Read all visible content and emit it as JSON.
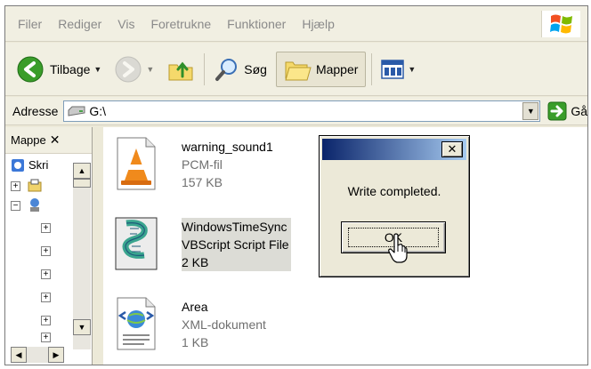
{
  "menubar": {
    "items": [
      "Filer",
      "Rediger",
      "Vis",
      "Foretrukne",
      "Funktioner",
      "Hjælp"
    ]
  },
  "toolbar": {
    "back_label": "Tilbage",
    "search_label": "Søg",
    "folders_label": "Mapper"
  },
  "address": {
    "label": "Adresse",
    "value": "G:\\",
    "go_label": "Gå"
  },
  "folder_pane": {
    "title": "Mappe",
    "tree_top_label": "Skri"
  },
  "files": [
    {
      "name": "warning_sound1",
      "type": "PCM-fil",
      "size": "157 KB",
      "icon": "vlc-cone-icon"
    },
    {
      "name": "WindowsTimeSync",
      "type": "VBScript Script File",
      "size": "2 KB",
      "icon": "vbscript-icon",
      "selected": true
    },
    {
      "name": "Area",
      "type": "XML-dokument",
      "size": "1 KB",
      "icon": "xml-document-icon"
    }
  ],
  "dialog": {
    "message": "Write completed.",
    "ok_label": "OK"
  },
  "colors": {
    "dialog_title_start": "#0a246a",
    "dialog_title_end": "#a6caf0",
    "back_button": "#3a9d2a",
    "window_bg": "#ece9d8"
  }
}
